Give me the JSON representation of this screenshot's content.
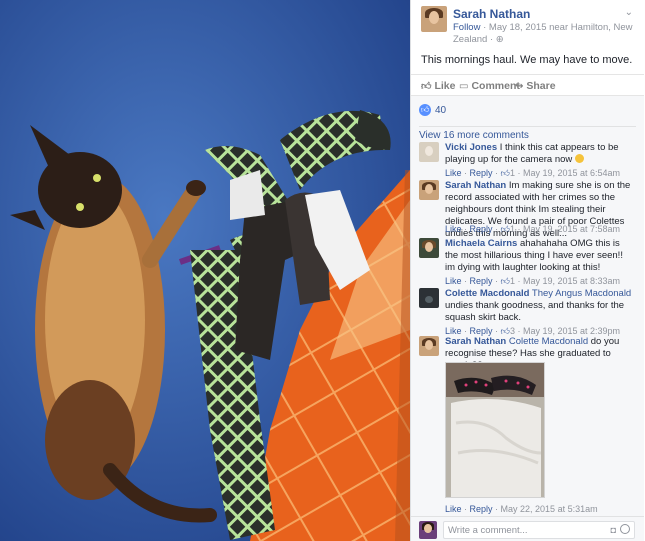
{
  "post": {
    "poster_name": "Sarah Nathan",
    "follow_label": "Follow",
    "meta_text": "May 18, 2015 near Hamilton, New Zealand",
    "chevron": "⌄",
    "text": "This mornings haul. We may have to move."
  },
  "actions": {
    "like": "Like",
    "comment": "Comment",
    "share": "Share"
  },
  "likes": {
    "count": "40"
  },
  "view_more": "View 16 more comments",
  "comments": [
    {
      "author": "Vicki Jones",
      "text": "I think this cat appears to be playing up for the camera now",
      "like": "Like",
      "reply": "Reply",
      "likes": "1",
      "time": "May 19, 2015 at 6:54am"
    },
    {
      "author": "Sarah Nathan",
      "text": "Im making sure she is on the record associated with her crimes so the neighbours dont think Im stealing their delicates. We found a pair of poor Colettes undies this morning as well...",
      "like": "Like",
      "reply": "Reply",
      "likes": "1",
      "time": "May 19, 2015 at 7:58am"
    },
    {
      "author": "Michaela Cairns",
      "text": "ahahahaha OMG this is the most hillarious thing I have ever seen!! im dying with laughter looking at this!",
      "like": "Like",
      "reply": "Reply",
      "likes": "1",
      "time": "May 19, 2015 at 8:33am"
    },
    {
      "author": "Colette Macdonald",
      "tag": "They Angus Macdonald",
      "text": "undies thank goodness, and thanks for the squash skirt back.",
      "like": "Like",
      "reply": "Reply",
      "likes": "3",
      "time": "May 19, 2015 at 2:39pm"
    },
    {
      "author": "Sarah Nathan",
      "tag": "Colette Macdonald",
      "text": "do you recognise these? Has she graduated to towels??",
      "like": "Like",
      "reply": "Reply",
      "time": "May 22, 2015 at 5:31am"
    }
  ],
  "write_comment": {
    "placeholder": "Write a comment..."
  },
  "colors": {
    "link": "#365899",
    "meta": "#90949c",
    "panel_bg": "#f6f7f9",
    "like_blue": "#5890ff"
  },
  "icons": [
    "thumbs-up-icon",
    "comment-icon",
    "share-icon",
    "globe-icon",
    "camera-icon",
    "smiley-icon"
  ]
}
